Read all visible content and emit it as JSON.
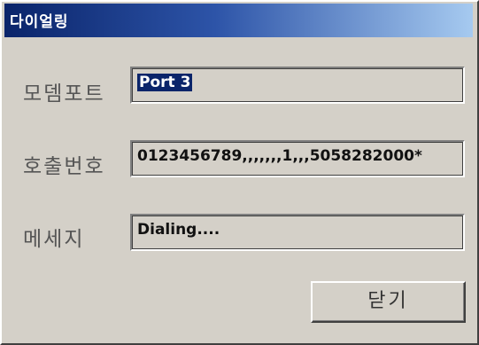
{
  "window": {
    "title": "다이얼링",
    "title_bar_color": "#0a246a"
  },
  "form": {
    "modem_port": {
      "label": "모뎀포트",
      "value": "Port 3"
    },
    "call_number": {
      "label": "호출번호",
      "value": "0123456789,,,,,,,1,,,5058282000*"
    },
    "message": {
      "label": "메세지",
      "value": "Dialing...."
    }
  },
  "buttons": {
    "close_label": "닫기"
  }
}
